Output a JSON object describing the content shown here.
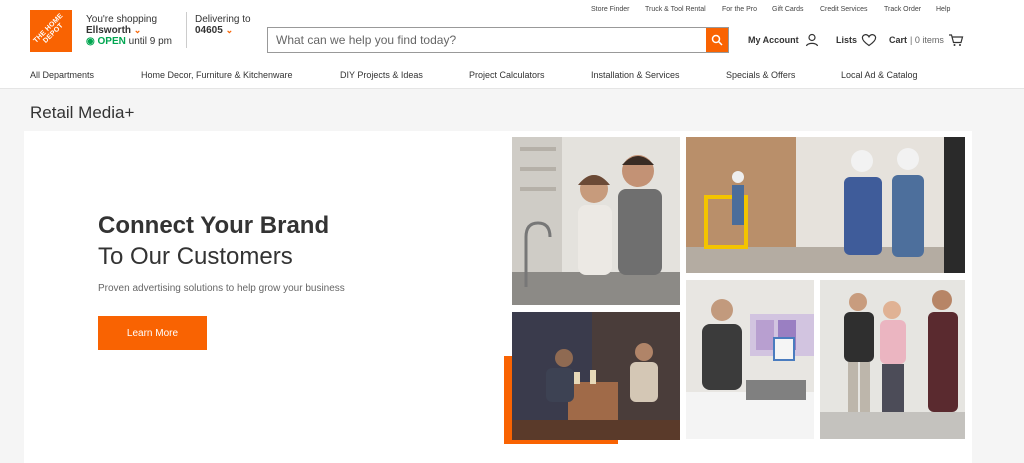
{
  "brand": {
    "logo_text": "THE HOME DEPOT",
    "accent": "#f96302"
  },
  "store": {
    "label": "You're shopping",
    "name": "Ellsworth",
    "status": "OPEN",
    "hours": "until 9 pm"
  },
  "delivery": {
    "label": "Delivering to",
    "zip": "04605"
  },
  "utility_links": [
    "Store Finder",
    "Truck & Tool Rental",
    "For the Pro",
    "Gift Cards",
    "Credit Services",
    "Track Order",
    "Help"
  ],
  "search": {
    "placeholder": "What can we help you find today?"
  },
  "account": {
    "my_account": "My Account",
    "lists": "Lists",
    "cart": "Cart",
    "cart_count": "| 0 items"
  },
  "nav": [
    "All Departments",
    "Home Decor, Furniture & Kitchenware",
    "DIY Projects & Ideas",
    "Project Calculators",
    "Installation & Services",
    "Specials & Offers",
    "Local Ad & Catalog"
  ],
  "page": {
    "title": "Retail Media+"
  },
  "hero": {
    "headline": "Connect Your Brand",
    "subheadline": "To Our Customers",
    "tagline": "Proven advertising solutions to help grow your business",
    "cta": "Learn More"
  },
  "icons": {
    "search": "search-icon",
    "account": "user-icon",
    "lists": "heart-icon",
    "cart": "cart-icon",
    "chevron": "chevron-down-icon",
    "open_status": "open-status-icon"
  },
  "colors": {
    "orange": "#f96302",
    "green": "#00a650"
  }
}
